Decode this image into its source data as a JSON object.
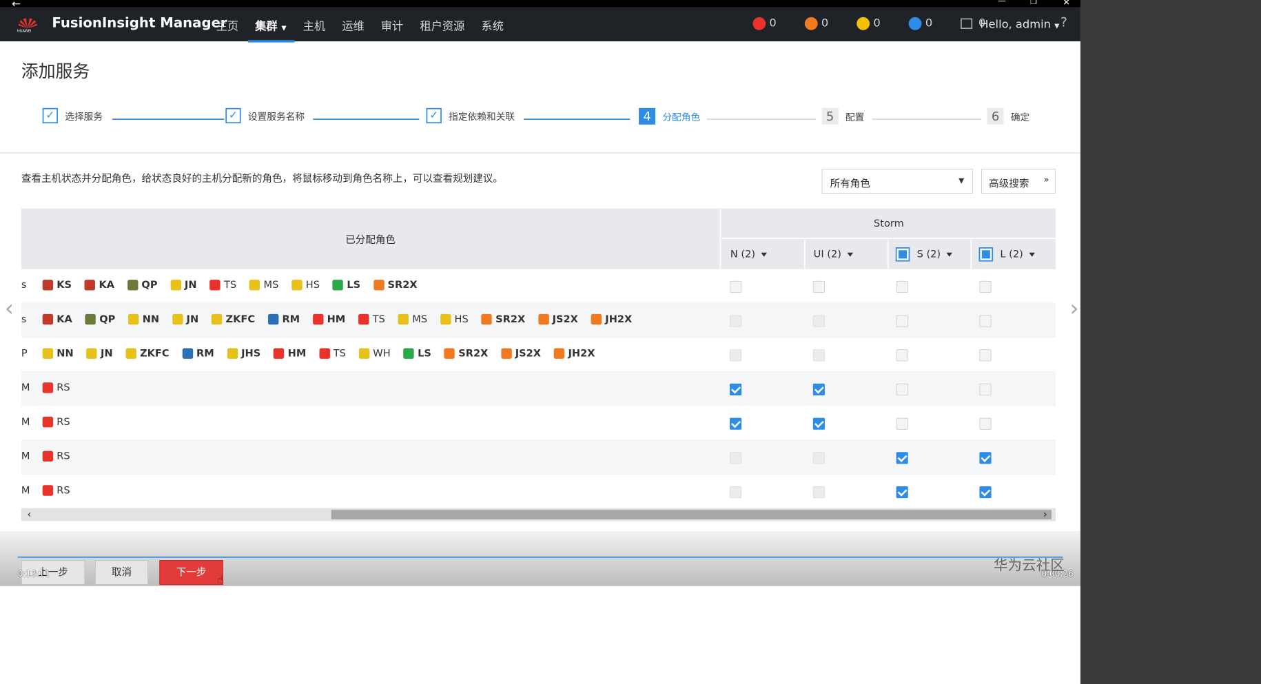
{
  "window": {
    "back": "←",
    "minimize": "—",
    "restore": "❐",
    "close": "✕"
  },
  "header": {
    "brand": "FusionInsight Manager",
    "logo_text": "HUAWEI",
    "nav": [
      "主页",
      "集群",
      "主机",
      "运维",
      "审计",
      "租户资源",
      "系统"
    ],
    "alerts": [
      {
        "value": "0",
        "color": "#e8332a"
      },
      {
        "value": "0",
        "color": "#f07a1f"
      },
      {
        "value": "0",
        "color": "#f5c000"
      },
      {
        "value": "0",
        "color": "#2d8ce8"
      },
      {
        "value": "0",
        "color": "#888888"
      }
    ],
    "user": "Hello, admin",
    "help": "?"
  },
  "page": {
    "title": "添加服务"
  },
  "steps": [
    {
      "n": "✓",
      "label": "选择服务"
    },
    {
      "n": "✓",
      "label": "设置服务名称"
    },
    {
      "n": "✓",
      "label": "指定依赖和关联"
    },
    {
      "n": "4",
      "label": "分配角色"
    },
    {
      "n": "5",
      "label": "配置"
    },
    {
      "n": "6",
      "label": "确定"
    }
  ],
  "description": "查看主机状态并分配角色，给状态良好的主机分配新的角色，将鼠标移动到角色名称上，可以查看规划建议。",
  "filter": {
    "value": "所有角色",
    "advanced": "高级搜索"
  },
  "table": {
    "assigned_header": "已分配角色",
    "group": "Storm",
    "cols": [
      {
        "label": "N (2)"
      },
      {
        "label": "UI (2)"
      },
      {
        "label": "S (2)"
      },
      {
        "label": "L (2)"
      }
    ],
    "rows": [
      {
        "cut": "s",
        "roles": [
          [
            "KS",
            1,
            "#c0392b"
          ],
          [
            "KA",
            1,
            "#c0392b"
          ],
          [
            "QP",
            1,
            "#6b7a3a"
          ],
          [
            "JN",
            1,
            "#e6c21a"
          ],
          [
            "TS",
            0,
            "#e8332a"
          ],
          [
            "MS",
            0,
            "#e6c21a"
          ],
          [
            "HS",
            0,
            "#e6c21a"
          ],
          [
            "LS",
            1,
            "#2aa84a"
          ],
          [
            "SR2X",
            1,
            "#f07a1f"
          ]
        ],
        "checks": [
          "off",
          "off",
          "off",
          "off"
        ]
      },
      {
        "cut": "s",
        "roles": [
          [
            "KA",
            1,
            "#c0392b"
          ],
          [
            "QP",
            1,
            "#6b7a3a"
          ],
          [
            "NN",
            1,
            "#e6c21a"
          ],
          [
            "JN",
            1,
            "#e6c21a"
          ],
          [
            "ZKFC",
            1,
            "#e6c21a"
          ],
          [
            "RM",
            1,
            "#2d6fb5"
          ],
          [
            "HM",
            1,
            "#e8332a"
          ],
          [
            "TS",
            0,
            "#e8332a"
          ],
          [
            "MS",
            0,
            "#e6c21a"
          ],
          [
            "HS",
            0,
            "#e6c21a"
          ],
          [
            "SR2X",
            1,
            "#f07a1f"
          ],
          [
            "JS2X",
            1,
            "#f07a1f"
          ],
          [
            "JH2X",
            1,
            "#f07a1f"
          ]
        ],
        "checks": [
          "dis",
          "dis",
          "off",
          "off"
        ]
      },
      {
        "cut": "P",
        "roles": [
          [
            "NN",
            1,
            "#e6c21a"
          ],
          [
            "JN",
            1,
            "#e6c21a"
          ],
          [
            "ZKFC",
            1,
            "#e6c21a"
          ],
          [
            "RM",
            1,
            "#2d6fb5"
          ],
          [
            "JHS",
            1,
            "#e6c21a"
          ],
          [
            "HM",
            1,
            "#e8332a"
          ],
          [
            "TS",
            0,
            "#e8332a"
          ],
          [
            "WH",
            0,
            "#e6c21a"
          ],
          [
            "LS",
            1,
            "#2aa84a"
          ],
          [
            "SR2X",
            1,
            "#f07a1f"
          ],
          [
            "JS2X",
            1,
            "#f07a1f"
          ],
          [
            "JH2X",
            1,
            "#f07a1f"
          ]
        ],
        "checks": [
          "dis",
          "dis",
          "off",
          "off"
        ]
      },
      {
        "cut": "M",
        "roles": [
          [
            "RS",
            0,
            "#e8332a"
          ]
        ],
        "checks": [
          "on",
          "on",
          "off",
          "off"
        ]
      },
      {
        "cut": "M",
        "roles": [
          [
            "RS",
            0,
            "#e8332a"
          ]
        ],
        "checks": [
          "on",
          "on",
          "off",
          "off"
        ]
      },
      {
        "cut": "M",
        "roles": [
          [
            "RS",
            0,
            "#e8332a"
          ]
        ],
        "checks": [
          "dis",
          "dis",
          "on",
          "on"
        ]
      },
      {
        "cut": "M",
        "roles": [
          [
            "RS",
            0,
            "#e8332a"
          ]
        ],
        "checks": [
          "dis",
          "dis",
          "on",
          "on"
        ]
      }
    ]
  },
  "footer": {
    "prev": "上一步",
    "cancel": "取消",
    "next": "下一步",
    "time_left": "0:13:11",
    "time_right": "0:00:26",
    "watermark": "华为云社区"
  }
}
